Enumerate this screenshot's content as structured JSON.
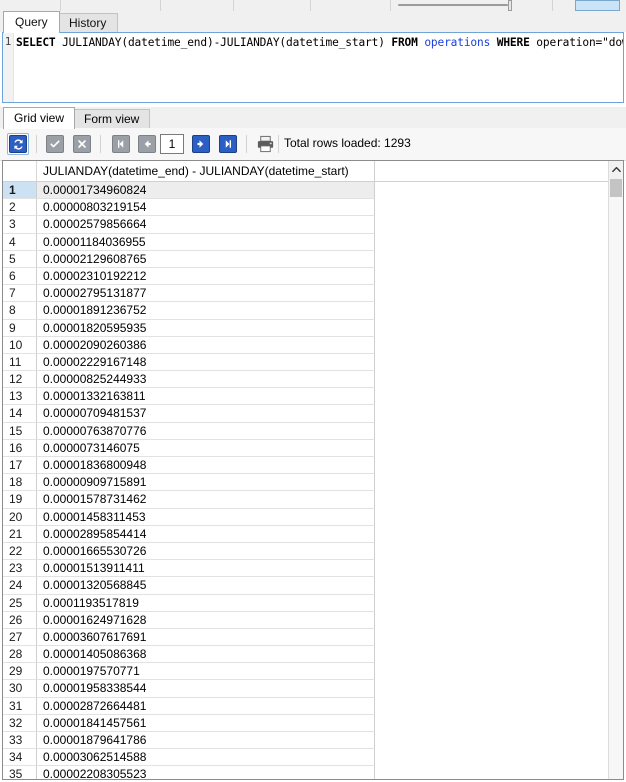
{
  "top_toolbar": {
    "slider_name": "zoom-slider",
    "blue_button_name": "highlighted-toolbar-button"
  },
  "editor_tabs": {
    "query_label": "Query",
    "history_label": "History",
    "active": "Query"
  },
  "sql": {
    "line_number": "1",
    "tokens": [
      {
        "text": "SELECT",
        "style": "kw"
      },
      {
        "text": " JULIANDAY(datetime_end)-JULIANDAY(datetime_start) ",
        "style": "plain"
      },
      {
        "text": "FROM",
        "style": "kw"
      },
      {
        "text": " ",
        "style": "plain"
      },
      {
        "text": "operations",
        "style": "tbl"
      },
      {
        "text": " ",
        "style": "plain"
      },
      {
        "text": "WHERE",
        "style": "kw"
      },
      {
        "text": " operation=\"download\";",
        "style": "plain"
      }
    ],
    "full_text": "SELECT JULIANDAY(datetime_end)-JULIANDAY(datetime_start) FROM operations WHERE operation=\"download\";"
  },
  "view_tabs": {
    "grid_label": "Grid view",
    "form_label": "Form view",
    "active": "Grid view"
  },
  "grid_toolbar": {
    "refresh_icon": "refresh-icon",
    "apply_icon": "checkmark-icon",
    "cancel_icon": "cross-icon",
    "first_icon": "first-page-icon",
    "prev_icon": "previous-page-icon",
    "next_icon": "next-page-icon",
    "last_icon": "last-page-icon",
    "print_icon": "printer-icon",
    "page_value": "1",
    "rows_loaded_text": "Total rows loaded: 1293",
    "accent_blue": "#2c5fc4",
    "disabled_gray": "#9aa0a6"
  },
  "results": {
    "column_header": "JULIANDAY(datetime_end) - JULIANDAY(datetime_start)",
    "selected_row": 1,
    "rows": [
      {
        "n": "1",
        "v": "0.00001734960824"
      },
      {
        "n": "2",
        "v": "0.00000803219154"
      },
      {
        "n": "3",
        "v": "0.00002579856664"
      },
      {
        "n": "4",
        "v": "0.00001184036955"
      },
      {
        "n": "5",
        "v": "0.00002129608765"
      },
      {
        "n": "6",
        "v": "0.00002310192212"
      },
      {
        "n": "7",
        "v": "0.00002795131877"
      },
      {
        "n": "8",
        "v": "0.00001891236752"
      },
      {
        "n": "9",
        "v": "0.00001820595935"
      },
      {
        "n": "10",
        "v": "0.00002090260386"
      },
      {
        "n": "11",
        "v": "0.00002229167148"
      },
      {
        "n": "12",
        "v": "0.00000825244933"
      },
      {
        "n": "13",
        "v": "0.00001332163811"
      },
      {
        "n": "14",
        "v": "0.00000709481537"
      },
      {
        "n": "15",
        "v": "0.00000763870776"
      },
      {
        "n": "16",
        "v": "0.0000073146075"
      },
      {
        "n": "17",
        "v": "0.00001836800948"
      },
      {
        "n": "18",
        "v": "0.00000909715891"
      },
      {
        "n": "19",
        "v": "0.00001578731462"
      },
      {
        "n": "20",
        "v": "0.00001458311453"
      },
      {
        "n": "21",
        "v": "0.00002895854414"
      },
      {
        "n": "22",
        "v": "0.00001665530726"
      },
      {
        "n": "23",
        "v": "0.00001513911411"
      },
      {
        "n": "24",
        "v": "0.00001320568845"
      },
      {
        "n": "25",
        "v": "0.0001193517819"
      },
      {
        "n": "26",
        "v": "0.00001624971628"
      },
      {
        "n": "27",
        "v": "0.00003607617691"
      },
      {
        "n": "28",
        "v": "0.00001405086368"
      },
      {
        "n": "29",
        "v": "0.0000197570771"
      },
      {
        "n": "30",
        "v": "0.00001958338544"
      },
      {
        "n": "31",
        "v": "0.00002872664481"
      },
      {
        "n": "32",
        "v": "0.00001841457561"
      },
      {
        "n": "33",
        "v": "0.00001879641786"
      },
      {
        "n": "34",
        "v": "0.00003062514588"
      },
      {
        "n": "35",
        "v": "0.00002208305523"
      }
    ]
  },
  "scrollbar": {
    "up_arrow_icon": "chevron-up-icon"
  }
}
